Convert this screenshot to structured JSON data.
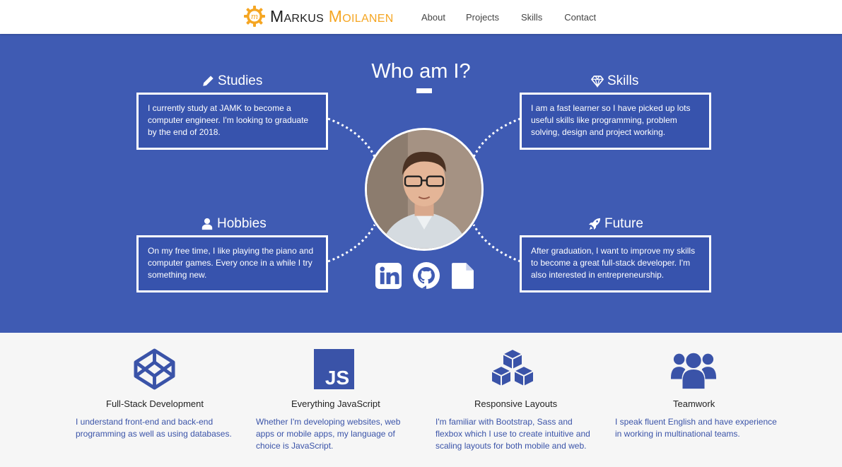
{
  "header": {
    "logo_mark": "m",
    "name_first": "Markus",
    "name_last": "Moilanen",
    "nav": [
      {
        "label": "About"
      },
      {
        "label": "Projects"
      },
      {
        "label": "Skills"
      },
      {
        "label": "Contact"
      }
    ]
  },
  "hero": {
    "title": "Who am I?",
    "sections": {
      "studies": {
        "heading": "Studies",
        "icon": "pencil-icon",
        "text": "I currently study at JAMK to become a computer engineer. I'm looking to graduate by the end of 2018."
      },
      "skills": {
        "heading": "Skills",
        "icon": "diamond-icon",
        "text": "I am a fast learner so I have picked up lots useful skills like programming, problem solving, design and project working."
      },
      "hobbies": {
        "heading": "Hobbies",
        "icon": "user-icon",
        "text": "On my free time, I like playing the piano and computer games. Every once in a while I try something new."
      },
      "future": {
        "heading": "Future",
        "icon": "rocket-icon",
        "text": "After graduation, I want to improve my skills to become a great full-stack developer. I'm also interested in entrepreneurship."
      }
    },
    "social_links": [
      {
        "icon": "linkedin-icon"
      },
      {
        "icon": "github-icon"
      },
      {
        "icon": "document-icon"
      }
    ]
  },
  "features": [
    {
      "icon": "codepen-icon",
      "title": "Full-Stack Development",
      "text": "I understand front-end and back-end programming as well as using databases."
    },
    {
      "icon": "javascript-icon",
      "icon_text": "JS",
      "title": "Everything JavaScript",
      "text": "Whether I'm developing websites, web apps or mobile apps, my language of choice is JavaScript."
    },
    {
      "icon": "cubes-icon",
      "title": "Responsive Layouts",
      "text": "I'm familiar with Bootstrap, Sass and flexbox which I use to create intuitive and scaling layouts for both mobile and web."
    },
    {
      "icon": "users-icon",
      "title": "Teamwork",
      "text": "I speak fluent English and have experience in working in multinational teams."
    }
  ],
  "colors": {
    "hero_background": "#3f5bb3",
    "accent_orange": "#f5a623",
    "feature_icon": "#3a53a8",
    "white": "#ffffff"
  }
}
